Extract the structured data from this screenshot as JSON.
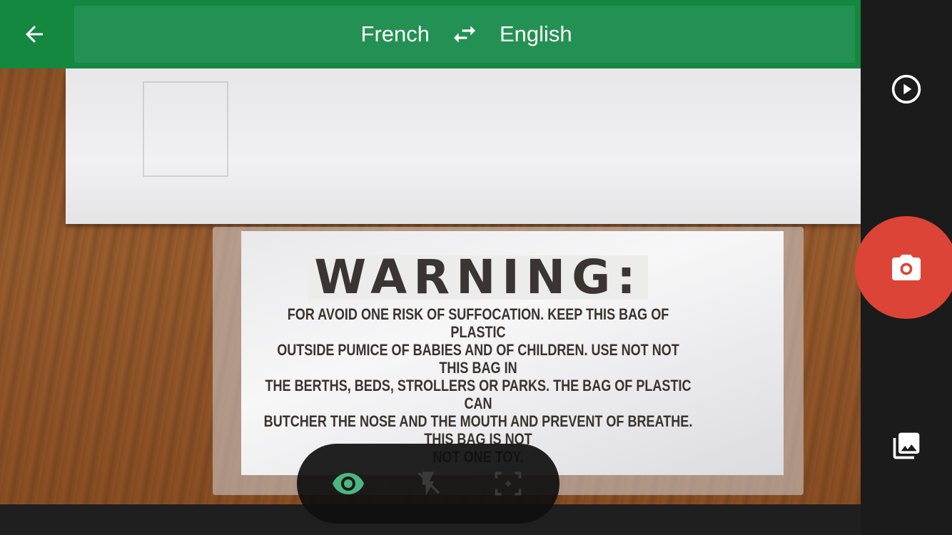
{
  "header": {
    "back_icon": "arrow-back-icon",
    "source_language": "French",
    "swap_icon": "swap-arrows-icon",
    "target_language": "English"
  },
  "viewfinder": {
    "translated_heading": "WARNING:",
    "translated_lines": [
      "FOR AVOID ONE RISK OF SUFFOCATION. KEEP THIS BAG OF PLASTIC",
      "OUTSIDE PUMICE OF BABIES AND OF CHILDREN. USE NOT NOT THIS BAG IN",
      "THE BERTHS, BEDS, STROLLERS OR PARKS. THE BAG OF PLASTIC CAN",
      "BUTCHER THE NOSE AND THE MOUTH AND PREVENT OF BREATHE. THIS BAG IS NOT",
      "NOT ONE TOY."
    ]
  },
  "sidebar": {
    "play_icon": "play-circle-icon",
    "shutter_icon": "camera-icon",
    "gallery_icon": "gallery-icon"
  },
  "toolbar": {
    "eye_icon": "eye-icon",
    "flash_icon": "flash-off-icon",
    "focus_icon": "focus-frame-icon"
  },
  "colors": {
    "header_green": "#13883e",
    "panel_green": "#239153",
    "shutter_red": "#dc4437",
    "eye_active": "#4cb682"
  }
}
